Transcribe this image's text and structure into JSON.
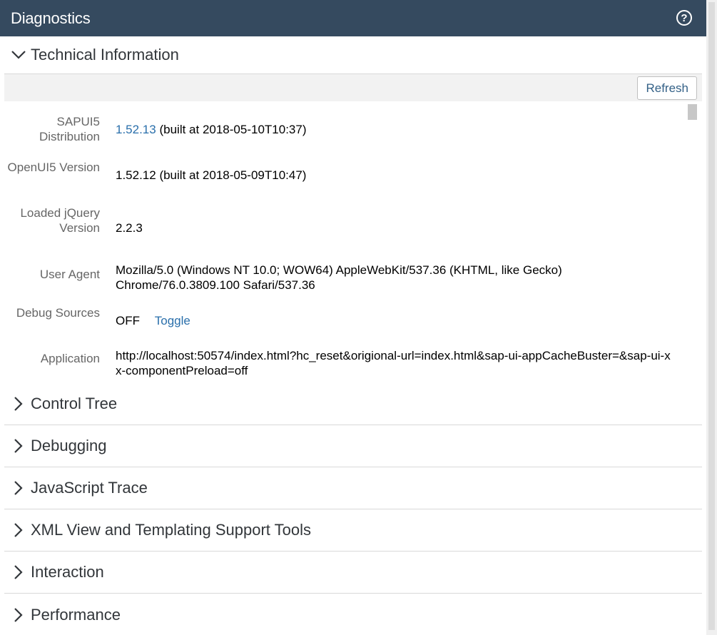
{
  "window": {
    "title": "Diagnostics",
    "help_icon": "help-circle-icon"
  },
  "technical_information": {
    "header": "Technical Information",
    "expanded": true,
    "refresh_label": "Refresh",
    "rows": {
      "sapui5": {
        "label": "SAPUI5 Distribution",
        "version_link": "1.52.13",
        "built": "(built at 2018-05-10T10:37)"
      },
      "openui5": {
        "label": "OpenUI5 Version",
        "value": "1.52.12 (built at 2018-05-09T10:47)"
      },
      "jquery": {
        "label": "Loaded jQuery Version",
        "value": "2.2.3"
      },
      "user_agent": {
        "label": "User Agent",
        "value": "Mozilla/5.0 (Windows NT 10.0; WOW64) AppleWebKit/537.36 (KHTML, like Gecko) Chrome/76.0.3809.100 Safari/537.36"
      },
      "debug_sources": {
        "label": "Debug Sources",
        "value": "OFF",
        "toggle_label": "Toggle"
      },
      "application": {
        "label": "Application",
        "value": "http://localhost:50574/index.html?hc_reset&origional-url=index.html&sap-ui-appCacheBuster=&sap-ui-xx-componentPreload=off"
      }
    }
  },
  "panels": [
    {
      "label": "Control Tree"
    },
    {
      "label": "Debugging"
    },
    {
      "label": "JavaScript Trace"
    },
    {
      "label": "XML View and Templating Support Tools"
    },
    {
      "label": "Interaction"
    },
    {
      "label": "Performance"
    }
  ]
}
